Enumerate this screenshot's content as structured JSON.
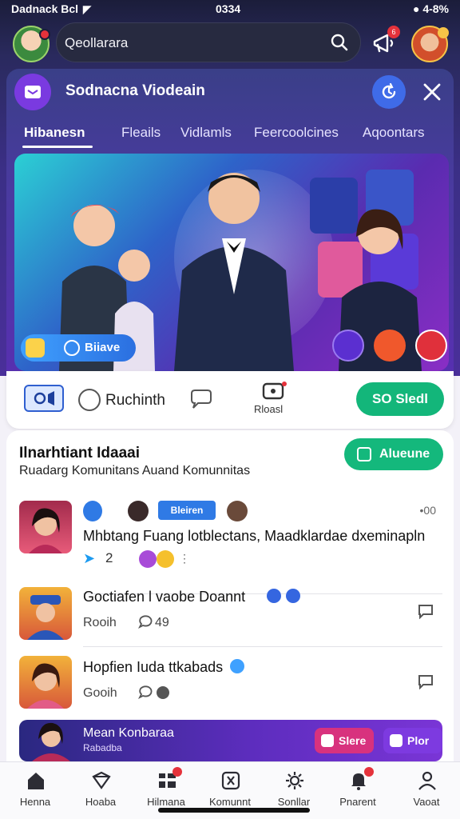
{
  "status_bar": {
    "carrier": "Dadnack Bcl",
    "time": "0334",
    "battery": "4-8%"
  },
  "search": {
    "placeholder": "Qeollarara"
  },
  "notification_badge": "6",
  "banner": {
    "title": "Sodnacna Viodeain",
    "tabs": [
      {
        "label": "Hibanesn",
        "active": true
      },
      {
        "label": "Fleails",
        "active": false
      },
      {
        "label": "Vidlamls",
        "active": false
      },
      {
        "label": "Feercoolcines",
        "active": false
      },
      {
        "label": "Aqoontars",
        "active": false
      }
    ],
    "live_label": "Biiave"
  },
  "actions": {
    "people_label": "Ruchinth",
    "record_label": "Rloasl",
    "send_label": "SO Sledl"
  },
  "community": {
    "title": "Ilnarhtiant Idaaai",
    "subtitle": "Ruadarg Komunitans Auand Komunnitas",
    "join_label": "Alueune",
    "posts": [
      {
        "time": "•00",
        "share_chip": "Bleiren",
        "title": "Mhbtang Fuang lotblectans, Maadklardae dxeminapln",
        "meta": "2"
      },
      {
        "title": "Goctiafen l vaobe Doannt",
        "meta_left": "Rooih",
        "meta_right": "49"
      },
      {
        "title": "Hopfien Iuda ttkabads",
        "meta_left": "Gooih"
      }
    ],
    "promo": {
      "title": "Mean Konbaraa",
      "subtitle": "Rabadba",
      "btn1": "Slere",
      "btn2": "Plor"
    }
  },
  "bottom_nav": [
    {
      "label": "Henna",
      "icon": "home-icon"
    },
    {
      "label": "Hoaba",
      "icon": "shield-icon"
    },
    {
      "label": "Hilmana",
      "icon": "grid-icon",
      "badge": true
    },
    {
      "label": "Komunnt",
      "icon": "community-icon"
    },
    {
      "label": "Sonllar",
      "icon": "settings-icon"
    },
    {
      "label": "Pnarent",
      "icon": "bell-icon",
      "badge": true
    },
    {
      "label": "Vaoat",
      "icon": "profile-icon"
    }
  ],
  "colors": {
    "accent_green": "#14b87c",
    "accent_blue": "#3f6be8",
    "header_purple": "#4a2f9a",
    "badge_red": "#e5323b"
  }
}
